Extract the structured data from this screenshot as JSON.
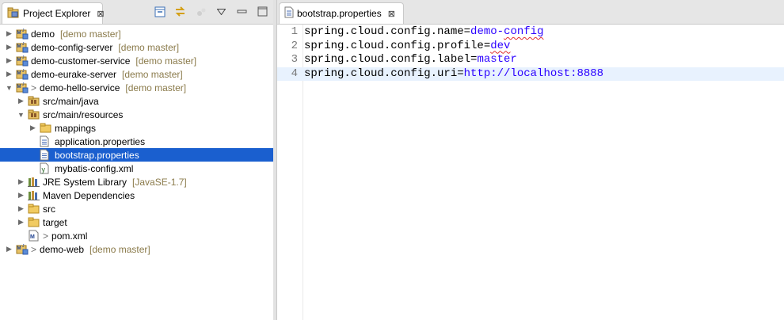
{
  "explorer": {
    "tab_title": "Project Explorer",
    "close_glyph": "⊠",
    "tree": [
      {
        "label": "demo",
        "branch": "[demo master]",
        "prefix": "",
        "expanded": false,
        "level": 0,
        "icon": "maven-project-icon"
      },
      {
        "label": "demo-config-server",
        "branch": "[demo master]",
        "prefix": "",
        "expanded": false,
        "level": 0,
        "icon": "maven-project-icon"
      },
      {
        "label": "demo-customer-service",
        "branch": "[demo master]",
        "prefix": "",
        "expanded": false,
        "level": 0,
        "icon": "maven-project-icon"
      },
      {
        "label": "demo-eurake-server",
        "branch": "[demo master]",
        "prefix": "",
        "expanded": false,
        "level": 0,
        "icon": "maven-project-icon"
      },
      {
        "label": "demo-hello-service",
        "branch": "[demo master]",
        "prefix": ">",
        "expanded": true,
        "level": 0,
        "icon": "maven-project-icon"
      },
      {
        "label": "src/main/java",
        "branch": "",
        "prefix": "",
        "expanded": false,
        "level": 1,
        "icon": "source-folder-icon"
      },
      {
        "label": "src/main/resources",
        "branch": "",
        "prefix": "",
        "expanded": true,
        "level": 1,
        "icon": "source-folder-icon"
      },
      {
        "label": "mappings",
        "branch": "",
        "prefix": "",
        "expanded": false,
        "level": 2,
        "icon": "folder-icon"
      },
      {
        "label": "application.properties",
        "branch": "",
        "prefix": "",
        "leaf": true,
        "level": 2,
        "icon": "properties-file-icon"
      },
      {
        "label": "bootstrap.properties",
        "branch": "",
        "prefix": "",
        "leaf": true,
        "level": 2,
        "icon": "properties-file-icon",
        "selected": true
      },
      {
        "label": "mybatis-config.xml",
        "branch": "",
        "prefix": "",
        "leaf": true,
        "level": 2,
        "icon": "xml-file-icon"
      },
      {
        "label": "JRE System Library",
        "branch": "[JavaSE-1.7]",
        "prefix": "",
        "expanded": false,
        "level": 1,
        "icon": "library-icon"
      },
      {
        "label": "Maven Dependencies",
        "branch": "",
        "prefix": "",
        "expanded": false,
        "level": 1,
        "icon": "library-icon"
      },
      {
        "label": "src",
        "branch": "",
        "prefix": "",
        "expanded": false,
        "level": 1,
        "icon": "folder-icon"
      },
      {
        "label": "target",
        "branch": "",
        "prefix": "",
        "expanded": false,
        "level": 1,
        "icon": "folder-icon"
      },
      {
        "label": "pom.xml",
        "branch": "",
        "prefix": ">",
        "leaf": true,
        "level": 1,
        "icon": "pom-file-icon"
      },
      {
        "label": "demo-web",
        "branch": "[demo master]",
        "prefix": ">",
        "expanded": false,
        "level": 0,
        "icon": "maven-project-icon"
      }
    ]
  },
  "editor": {
    "tab_title": "bootstrap.properties",
    "close_glyph": "⊠",
    "lines": [
      {
        "num": "1",
        "key": "spring.cloud.config.name",
        "value": "demo-config",
        "squiggle": "config"
      },
      {
        "num": "2",
        "key": "spring.cloud.config.profile",
        "value": "dev",
        "squiggle": "dev"
      },
      {
        "num": "3",
        "key": "spring.cloud.config.label",
        "value": "master",
        "squiggle": ""
      },
      {
        "num": "4",
        "key": "spring.cloud.config.uri",
        "value": "http://localhost:8888",
        "squiggle": "",
        "current": true
      }
    ]
  },
  "colors": {
    "selection": "#1a5fcf",
    "value_text": "#2a00ff",
    "branch_text": "#8a7a4a"
  }
}
